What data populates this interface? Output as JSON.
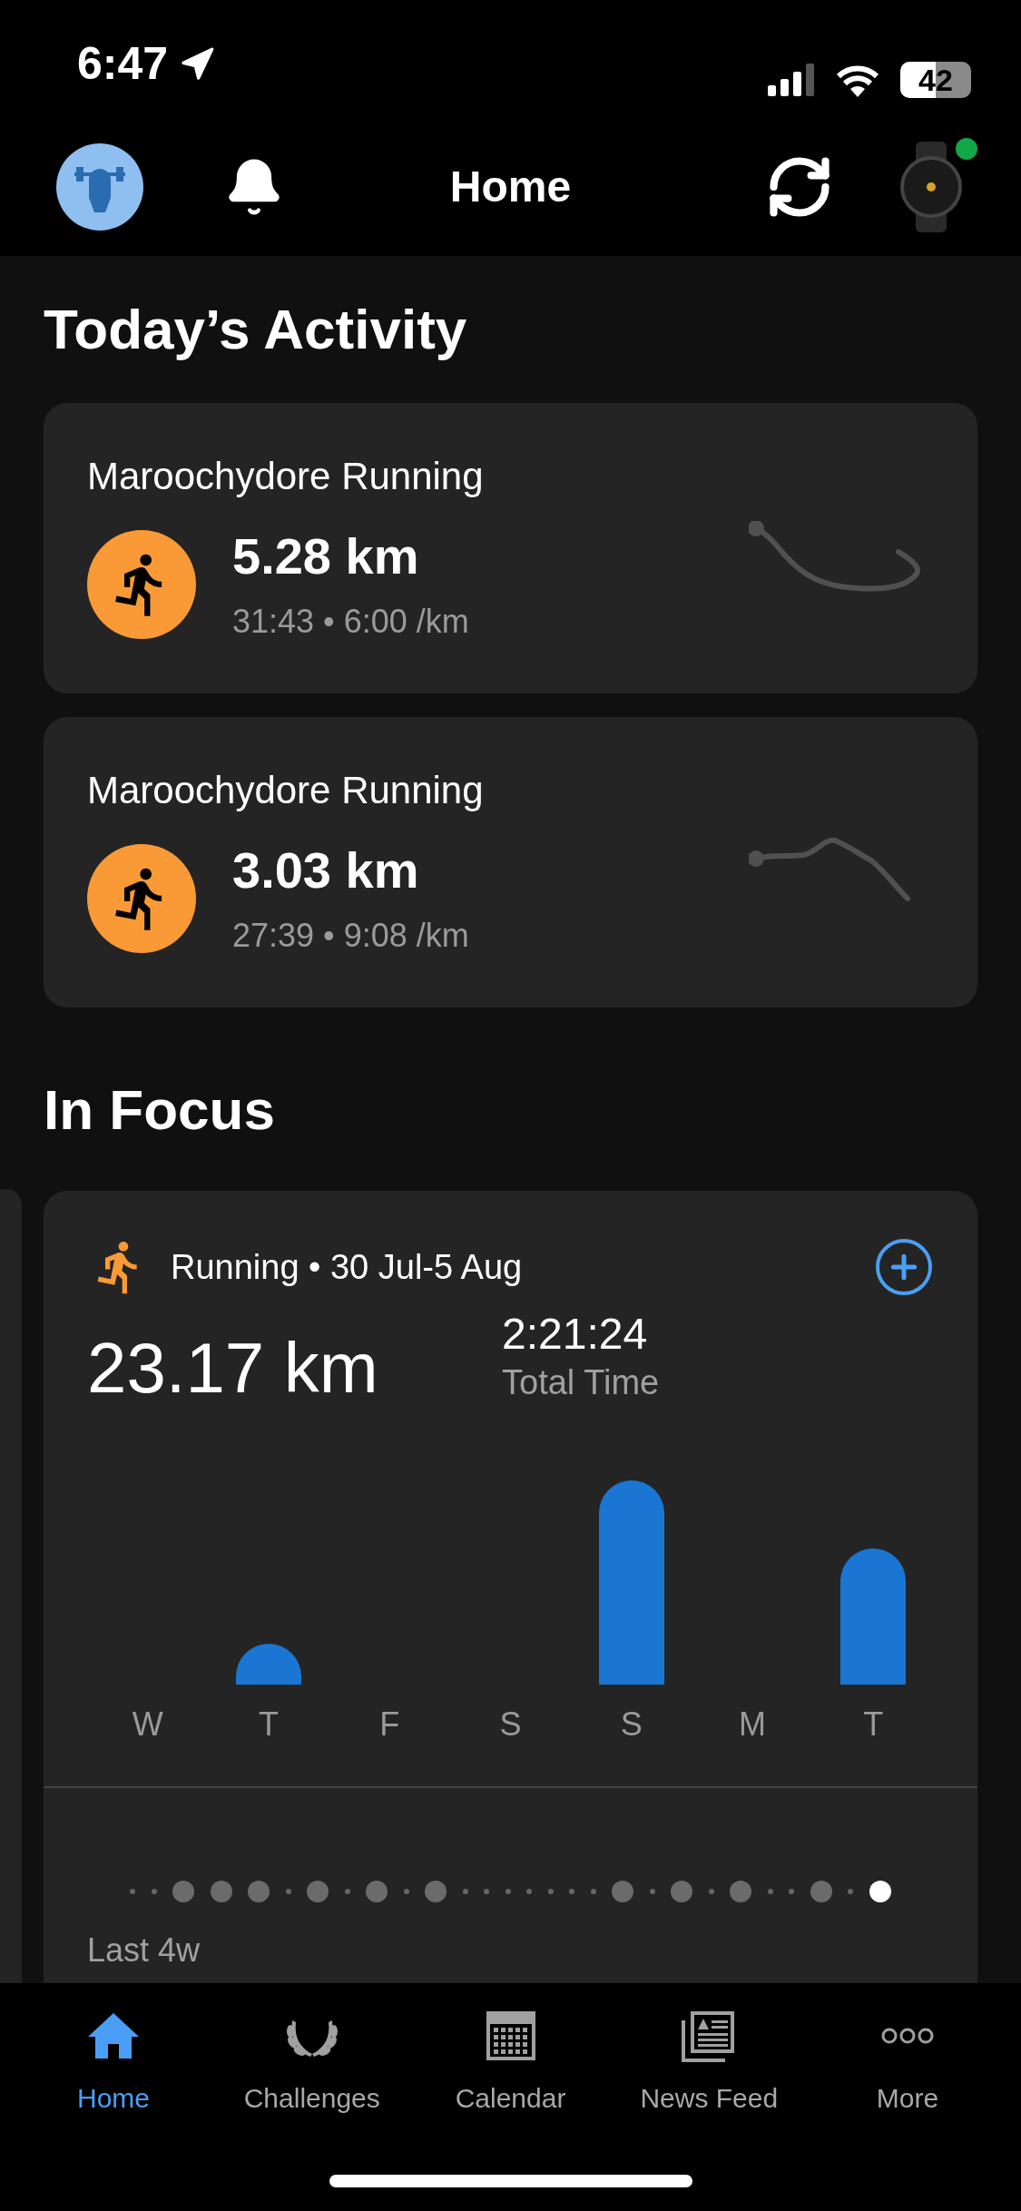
{
  "status_bar": {
    "time": "6:47",
    "battery": "42"
  },
  "nav": {
    "title": "Home",
    "device_connected": true
  },
  "today": {
    "heading": "Today’s Activity",
    "activities": [
      {
        "title": "Maroochydore Running",
        "distance": "5.28 km",
        "meta": "31:43 • 6:00 /km"
      },
      {
        "title": "Maroochydore Running",
        "distance": "3.03 km",
        "meta": "27:39 • 9:08 /km"
      }
    ]
  },
  "focus": {
    "heading": "In Focus",
    "header": "Running • 30 Jul-5 Aug",
    "distance": "23.17 km",
    "total_time": "2:21:24",
    "total_time_label": "Total Time",
    "days": [
      "W",
      "T",
      "F",
      "S",
      "S",
      "M",
      "T"
    ],
    "period": "Last 4w"
  },
  "tabs": [
    {
      "label": "Home",
      "selected": true
    },
    {
      "label": "Challenges",
      "selected": false
    },
    {
      "label": "Calendar",
      "selected": false
    },
    {
      "label": "News Feed",
      "selected": false
    },
    {
      "label": "More",
      "selected": false
    }
  ]
}
